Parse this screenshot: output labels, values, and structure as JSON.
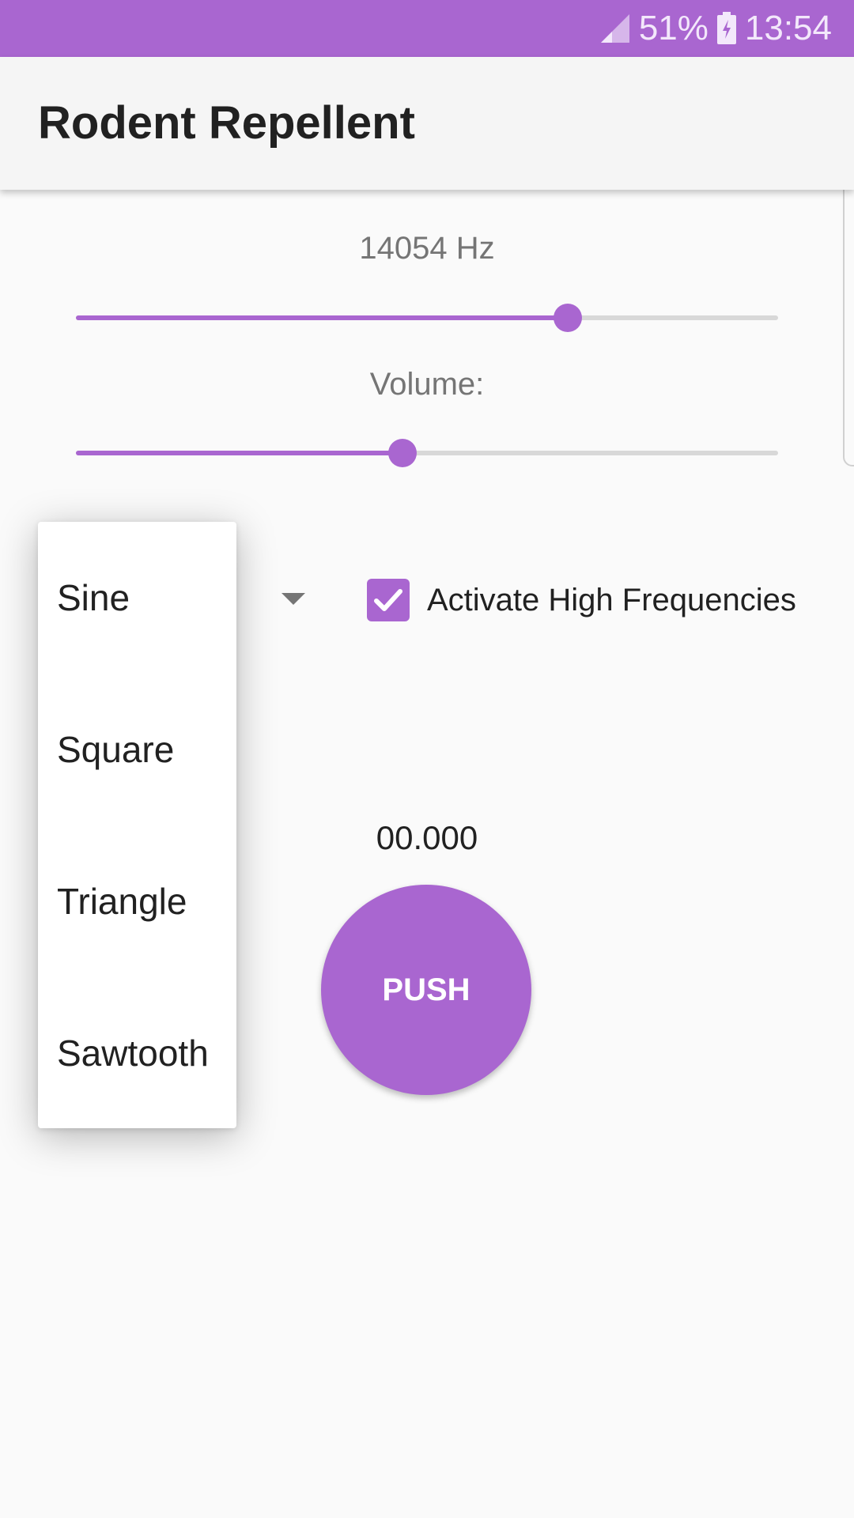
{
  "status_bar": {
    "battery_percent": "51%",
    "time": "13:54",
    "color": "#a966d0"
  },
  "app_bar": {
    "title": "Rodent Repellent"
  },
  "frequency": {
    "label": "14054 Hz",
    "slider_fraction": 0.7
  },
  "volume": {
    "label": "Volume:",
    "slider_fraction": 0.465
  },
  "waveform": {
    "options": [
      "Sine",
      "Square",
      "Triangle",
      "Sawtooth"
    ],
    "selected": "Sine"
  },
  "high_freq": {
    "label": "Activate High Frequencies",
    "checked": true
  },
  "timer": {
    "value": "00.000"
  },
  "push_button": {
    "label": "PUSH"
  },
  "colors": {
    "accent": "#a966d0"
  }
}
